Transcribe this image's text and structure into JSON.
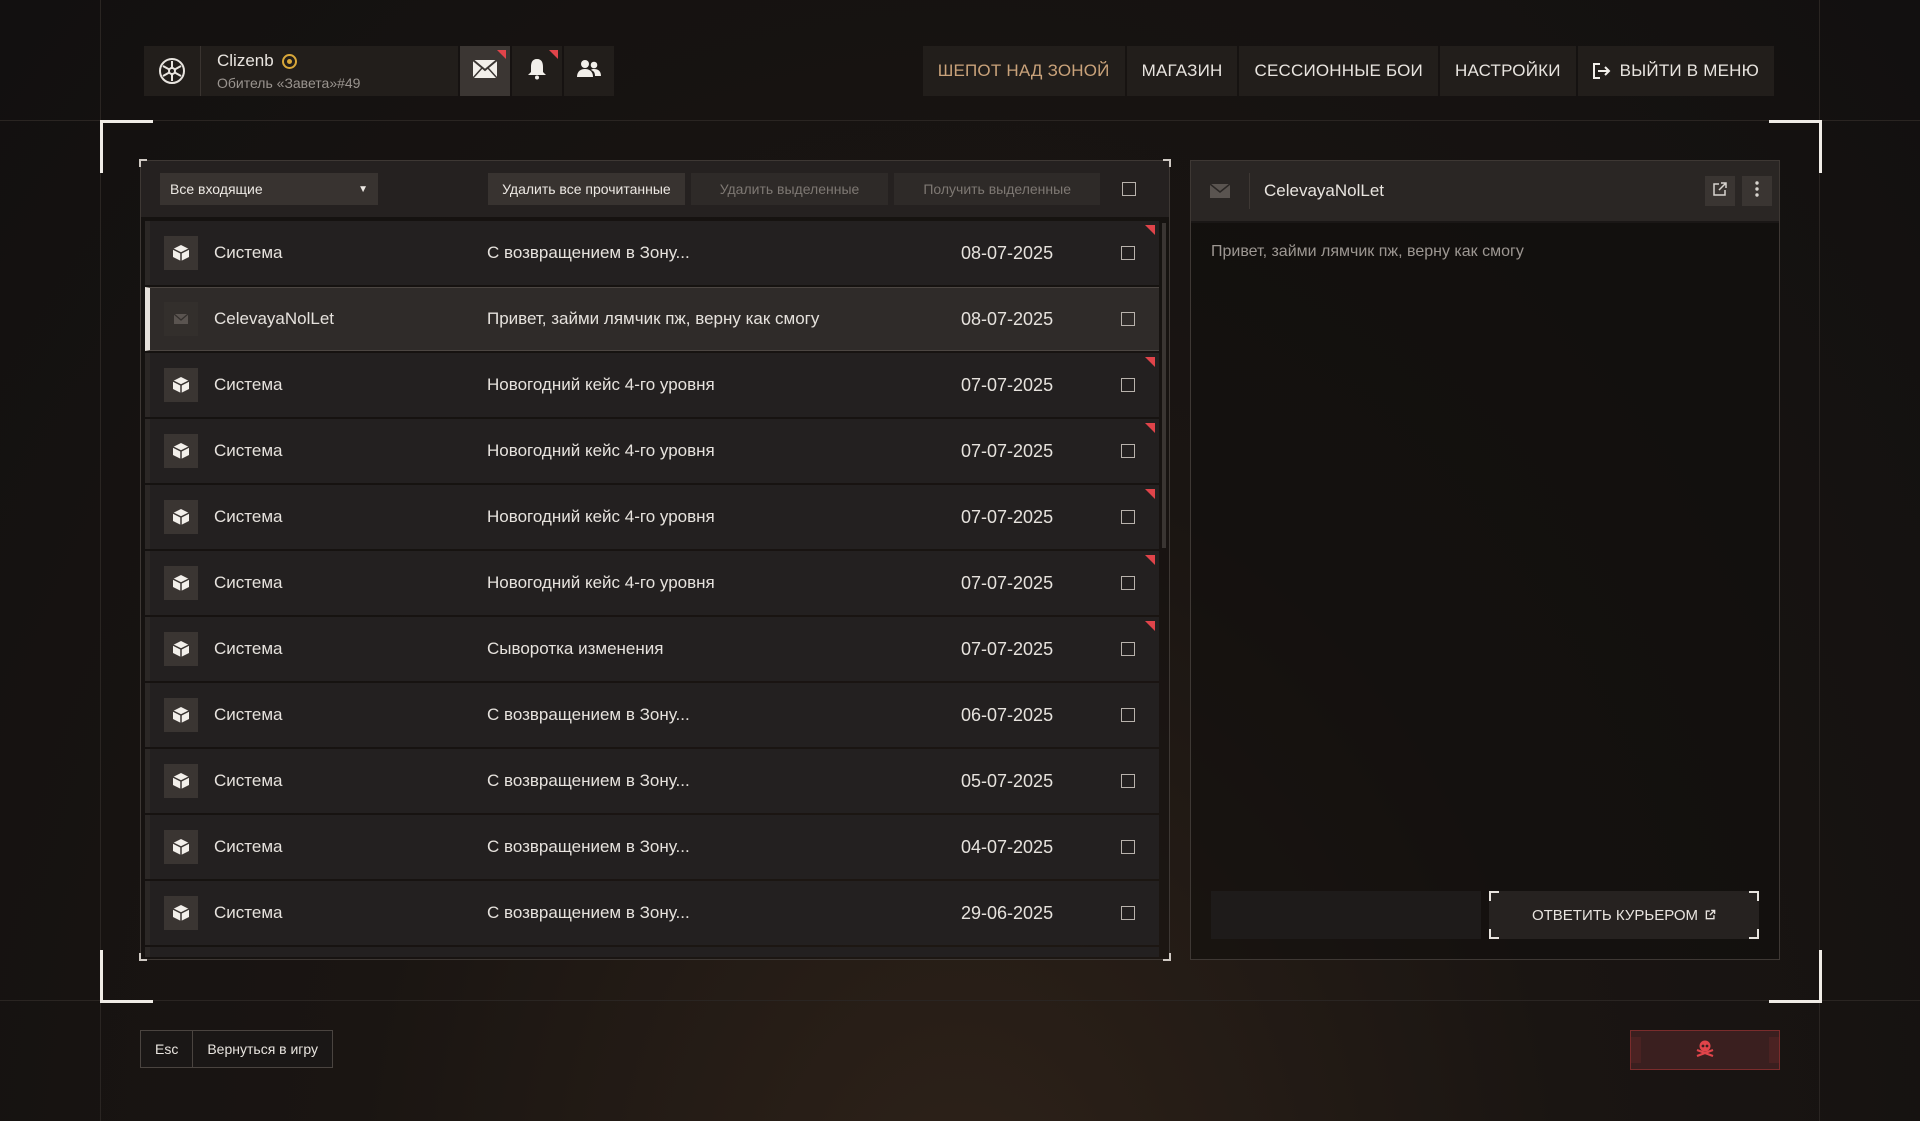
{
  "profile": {
    "name": "Clizenb",
    "subtitle": "Обитель «Завета»#49",
    "badge_icon": "sun-badge-icon"
  },
  "top_buttons": [
    {
      "name": "mail-icon",
      "active": true,
      "unread": true
    },
    {
      "name": "bell-icon",
      "active": false,
      "unread": true
    },
    {
      "name": "friends-icon",
      "active": false,
      "unread": false
    }
  ],
  "nav": {
    "whisper": "ШЕПОТ НАД ЗОНОЙ",
    "shop": "МАГАЗИН",
    "sessions": "СЕССИОННЫЕ БОИ",
    "settings": "НАСТРОЙКИ",
    "exit": "ВЫЙТИ В МЕНЮ"
  },
  "toolbar": {
    "filter_value": "Все входящие",
    "delete_read": "Удалить все прочитанные",
    "delete_selected": "Удалить выделенные",
    "receive_selected": "Получить выделенные"
  },
  "messages": [
    {
      "sender": "Система",
      "subject": "С возвращением в Зону...",
      "date": "08-07-2025",
      "unread": true,
      "selected": false,
      "icon": "box-icon"
    },
    {
      "sender": "CelevayaNolLet",
      "subject": "Привет, займи лямчик пж, верну как смогу",
      "date": "08-07-2025",
      "unread": false,
      "selected": true,
      "icon": "envelope-icon"
    },
    {
      "sender": "Система",
      "subject": "Новогодний кейс 4-го уровня",
      "date": "07-07-2025",
      "unread": true,
      "selected": false,
      "icon": "box-icon"
    },
    {
      "sender": "Система",
      "subject": "Новогодний кейс 4-го уровня",
      "date": "07-07-2025",
      "unread": true,
      "selected": false,
      "icon": "box-icon"
    },
    {
      "sender": "Система",
      "subject": "Новогодний кейс 4-го уровня",
      "date": "07-07-2025",
      "unread": true,
      "selected": false,
      "icon": "box-icon"
    },
    {
      "sender": "Система",
      "subject": "Новогодний кейс 4-го уровня",
      "date": "07-07-2025",
      "unread": true,
      "selected": false,
      "icon": "box-icon"
    },
    {
      "sender": "Система",
      "subject": "Сыворотка изменения",
      "date": "07-07-2025",
      "unread": true,
      "selected": false,
      "icon": "box-icon"
    },
    {
      "sender": "Система",
      "subject": "С возвращением в Зону...",
      "date": "06-07-2025",
      "unread": false,
      "selected": false,
      "icon": "box-icon"
    },
    {
      "sender": "Система",
      "subject": "С возвращением в Зону...",
      "date": "05-07-2025",
      "unread": false,
      "selected": false,
      "icon": "box-icon"
    },
    {
      "sender": "Система",
      "subject": "С возвращением в Зону...",
      "date": "04-07-2025",
      "unread": false,
      "selected": false,
      "icon": "box-icon"
    },
    {
      "sender": "Система",
      "subject": "С возвращением в Зону...",
      "date": "29-06-2025",
      "unread": false,
      "selected": false,
      "icon": "box-icon"
    }
  ],
  "detail": {
    "sender": "CelevayaNolLet",
    "body": "Привет, займи лямчик пж, верну как смогу",
    "reply_label": "ОТВЕТИТЬ КУРЬЕРОМ"
  },
  "bottom": {
    "esc_key": "Esc",
    "back_label": "Вернуться в игру",
    "danger_icon": "skull-crossbones-icon"
  },
  "colors": {
    "accent_red": "#e0444a",
    "nav_active": "#c9a27a",
    "background": "#161312"
  }
}
